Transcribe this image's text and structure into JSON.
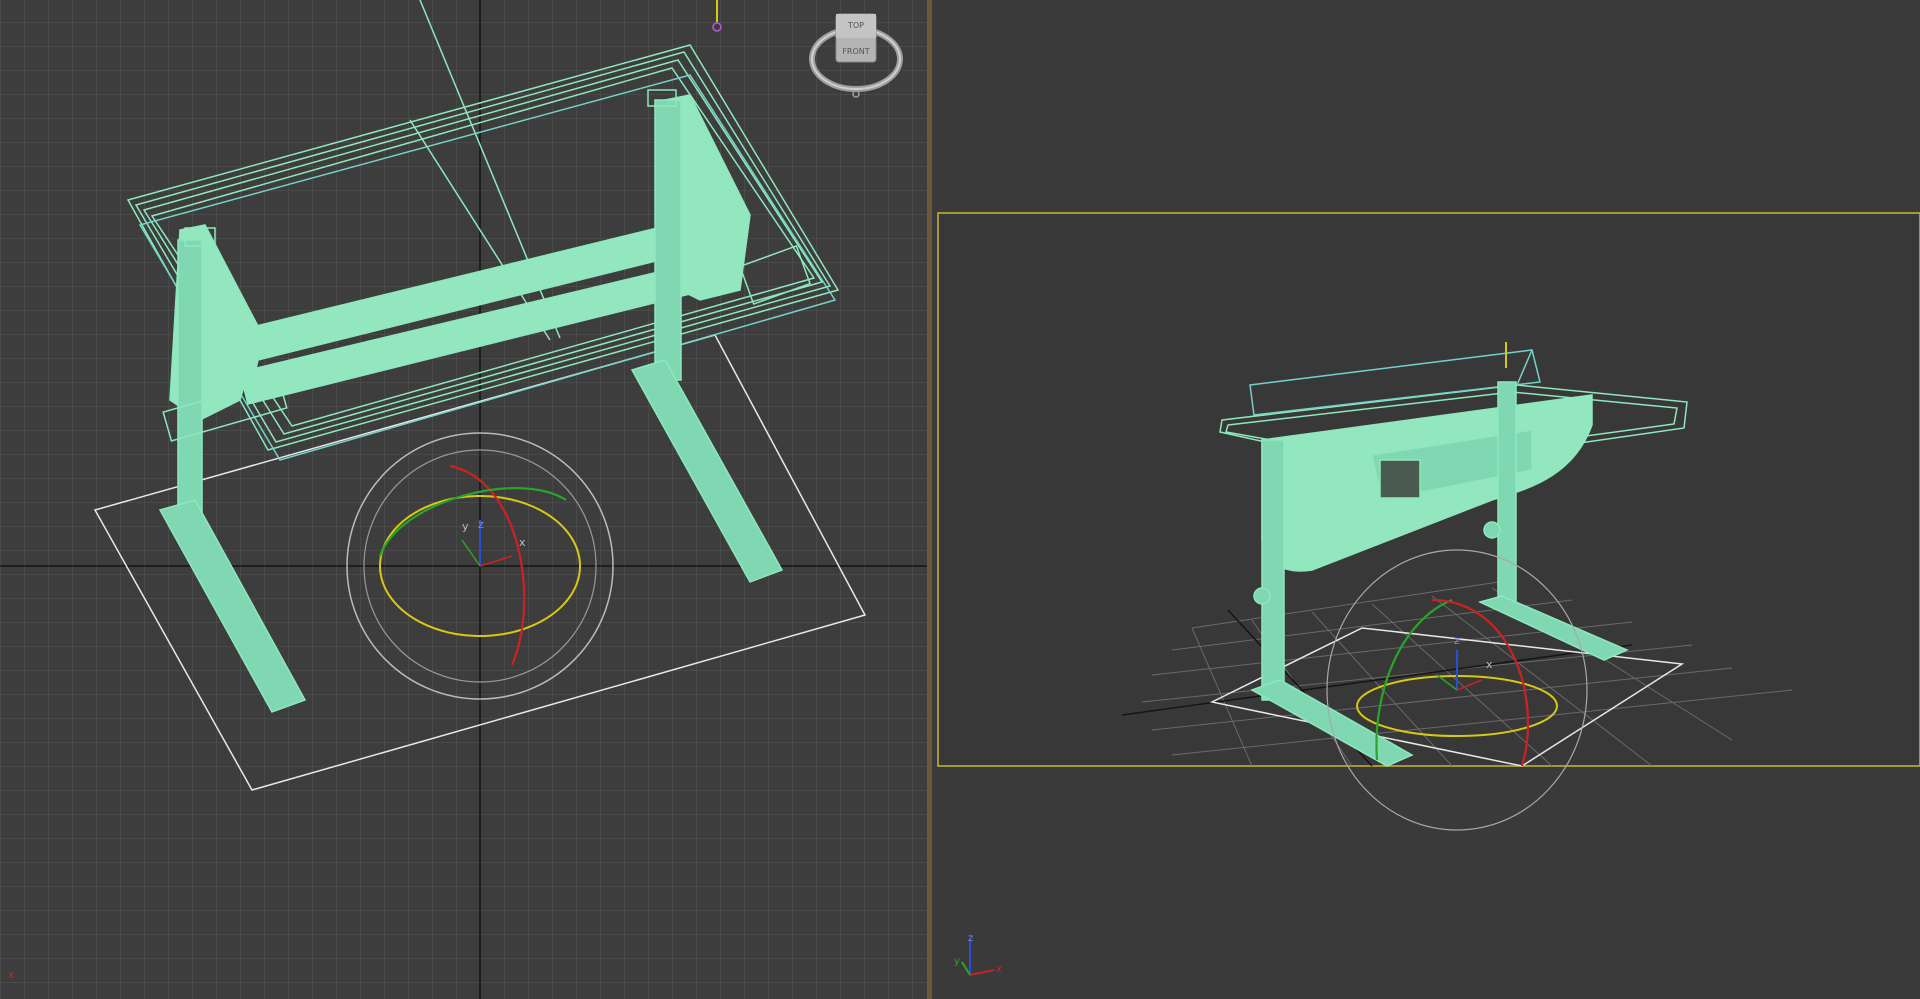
{
  "app": {
    "title": ""
  },
  "viewports": {
    "left": {
      "name": "",
      "viewcube": {
        "top_label": "TOP",
        "front_label": "FRONT"
      },
      "axis_labels": {
        "x": "x",
        "y": "y",
        "z": "z",
        "corner_x": "x"
      }
    },
    "right": {
      "name": "",
      "axis_labels": {
        "x": "x",
        "y": "y",
        "z": "z"
      }
    }
  },
  "colors": {
    "viewport_bg": "#3c3c3c",
    "grid_line": "#575757",
    "object_wire": "#8ee8bd",
    "object_fill": "#93e7bf",
    "selection_box": "#ffffff",
    "active_frame": "#c8b834",
    "gizmo_x": "#cc2222",
    "gizmo_y": "#2aa52a",
    "gizmo_z": "#2b4fd0",
    "gizmo_screen": "#d8c816"
  }
}
